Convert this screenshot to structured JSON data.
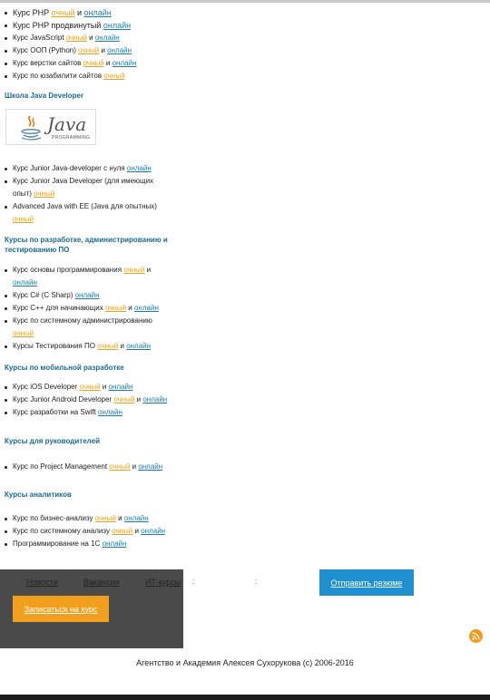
{
  "labels": {
    "och": "очный",
    "onl": "онлайн",
    "and": "и"
  },
  "php_group": [
    {
      "title": "Курс PHP",
      "och": true,
      "onl": true,
      "big": true
    },
    {
      "title": "Курс PHP продвинутый",
      "onl": true,
      "big": true
    },
    {
      "title": "Курс JavaScript",
      "och": true,
      "onl": true
    },
    {
      "title": "Курс ООП (Python)",
      "och": true,
      "onl": true
    },
    {
      "title": "Курс верстки сайтов",
      "och": true,
      "onl": true
    },
    {
      "title": "Курс по юзабилити сайтов",
      "och": true
    }
  ],
  "java_section": {
    "heading": "Школа Java Developer",
    "logo_word": "Java",
    "logo_sub": "PROGRAMMING",
    "items": [
      {
        "title": "Курс Junior Java-developer  с нуля",
        "onl": true
      },
      {
        "title": "Курс Junior Java Developer (для имеющих опыт)",
        "och": true
      },
      {
        "title": "Advanced Java with EE (Java для опытных)",
        "och": true
      }
    ]
  },
  "dev_section": {
    "heading": "Курсы по разработке, администрированию и тестированию ПО",
    "items": [
      {
        "title": "Курс основы программирования",
        "och": true,
        "onl": true
      },
      {
        "title": "Курс C# (C Sharp)",
        "onl": true
      },
      {
        "title": "Курс C++ для начинающих",
        "och": true,
        "onl": true
      },
      {
        "title": "Курс по системному администрированию",
        "och": true
      },
      {
        "title": "Курсы Тестирования ПО",
        "och": true,
        "onl": true
      }
    ]
  },
  "mobile_section": {
    "heading": "Курсы по мобильной разработке",
    "items": [
      {
        "title": "Курс iOS Developer",
        "och": true,
        "onl": true
      },
      {
        "title": "Курс Junior Android Developer",
        "och": true,
        "onl": true
      },
      {
        "title": "Курс разработки на Swift",
        "onl": true
      }
    ]
  },
  "lead_section": {
    "heading": "Курсы для руководителей",
    "items": [
      {
        "title": "Курс по Project Management",
        "och": true,
        "onl": true
      }
    ]
  },
  "analyst_section": {
    "heading": "Курсы аналитиков",
    "items": [
      {
        "title": "Курс по бизнес-анализу",
        "och": true,
        "onl": true
      },
      {
        "title": "Курс по системному анализу",
        "och": true,
        "onl": true
      },
      {
        "title": "Программирование на 1С",
        "onl": true
      }
    ]
  },
  "footer": {
    "nav": [
      "Новости",
      "Вакансии",
      "ИТ-курсы"
    ],
    "separators": [
      ":",
      ":",
      ":",
      ":"
    ],
    "send_resume": "Отправить резюме",
    "enroll": "Записаться на курс",
    "copyright": "Агентство и Академия Алексея Сухорукова (с) 2006-2016",
    "rss_icon": "rss-icon"
  },
  "colors": {
    "och": "#e8a317",
    "onl": "#1a7fa8",
    "heading": "#1a6a8c",
    "resume_btn": "#1e90d0",
    "enroll_btn": "#f0a01e",
    "footer_bg": "#4a4a4a"
  }
}
